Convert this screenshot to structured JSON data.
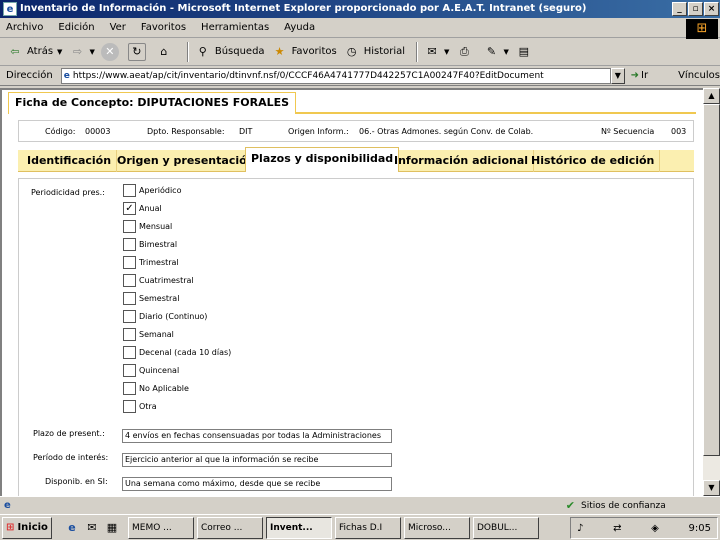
{
  "window": {
    "title": "Inventario de Información - Microsoft Internet Explorer proporcionado por A.E.A.T. Intranet (seguro)"
  },
  "menu": [
    "Archivo",
    "Edición",
    "Ver",
    "Favoritos",
    "Herramientas",
    "Ayuda"
  ],
  "toolbar": {
    "back": "Atrás",
    "search": "Búsqueda",
    "favorites": "Favoritos",
    "history": "Historial"
  },
  "address": {
    "label": "Dirección",
    "url": "https://www.aeat/ap/cit/inventario/dtinvnf.nsf/0/CCCF46A4741777D442257C1A00247F40?EditDocument",
    "go": "Ir",
    "links": "Vínculos"
  },
  "page": {
    "title": "Ficha de Concepto: DIPUTACIONES FORALES",
    "info": {
      "codigo_label": "Código:",
      "codigo": "00003",
      "dpto_label": "Dpto. Responsable:",
      "dpto": "DIT",
      "origen_label": "Origen Inform.:",
      "origen": "06.- Otras Admones. según Conv. de Colab.",
      "secuencia_label": "Nº Secuencia",
      "secuencia": "003"
    },
    "tabs": [
      "Identificación",
      "Origen y presentación",
      "Plazos y disponibilidad",
      "Información adicional",
      "Histórico de edición"
    ],
    "active_tab": 2,
    "form": {
      "periodicidad_label": "Periodicidad pres.:",
      "options": [
        {
          "label": "Aperiódico",
          "checked": false
        },
        {
          "label": "Anual",
          "checked": true
        },
        {
          "label": "Mensual",
          "checked": false
        },
        {
          "label": "Bimestral",
          "checked": false
        },
        {
          "label": "Trimestral",
          "checked": false
        },
        {
          "label": "Cuatrimestral",
          "checked": false
        },
        {
          "label": "Semestral",
          "checked": false
        },
        {
          "label": "Diario (Continuo)",
          "checked": false
        },
        {
          "label": "Semanal",
          "checked": false
        },
        {
          "label": "Decenal (cada 10 días)",
          "checked": false
        },
        {
          "label": "Quincenal",
          "checked": false
        },
        {
          "label": "No Aplicable",
          "checked": false
        },
        {
          "label": "Otra",
          "checked": false
        }
      ],
      "plazo_label": "Plazo de present.:",
      "plazo_value": "4 envíos en fechas consensuadas por todas la Administraciones",
      "periodo_label": "Período de interés:",
      "periodo_value": "Ejercicio anterior al que la información se recibe",
      "disponib_label": "Disponib. en SI:",
      "disponib_value": "Una semana como máximo, desde que se recibe"
    }
  },
  "status": {
    "zone": "Sitios de confianza"
  },
  "taskbar": {
    "start": "Inicio",
    "tasks": [
      "MEMO ...",
      "Correo ...",
      "Invent...",
      "Fichas D.I",
      "Microso...",
      "DOBUL..."
    ],
    "active_task": 2,
    "clock": "9:05"
  }
}
